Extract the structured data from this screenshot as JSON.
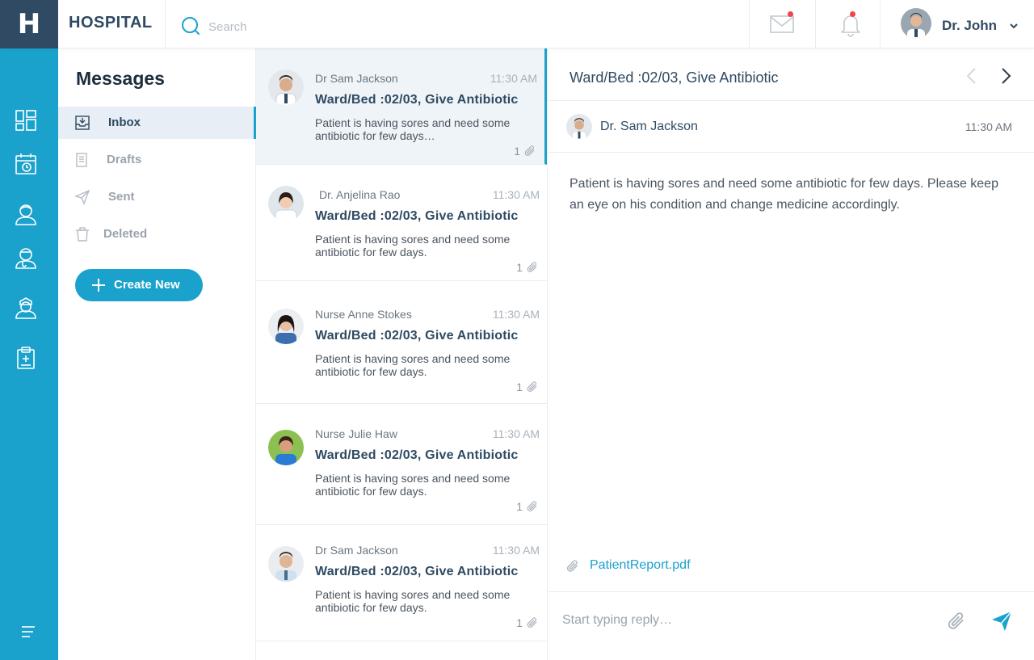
{
  "app": {
    "logo_letter": "H",
    "brand": "HOSPITAL"
  },
  "header": {
    "search_placeholder": "Search",
    "user_name": "Dr. John"
  },
  "folders": {
    "title": "Messages",
    "items": [
      {
        "label": "Inbox",
        "icon": "inbox-icon",
        "active": true
      },
      {
        "label": "Drafts",
        "icon": "drafts-icon",
        "active": false
      },
      {
        "label": "Sent",
        "icon": "sent-icon",
        "active": false
      },
      {
        "label": "Deleted",
        "icon": "trash-icon",
        "active": false
      }
    ],
    "create_label": "Create New"
  },
  "rail": {
    "icons": [
      "dashboard-icon",
      "appointments-icon",
      "patients-icon",
      "doctors-icon",
      "nurses-icon",
      "clipboard-icon",
      "menu-icon"
    ]
  },
  "messages": [
    {
      "sender": "Dr Sam Jackson",
      "time": "11:30 AM",
      "subject": "Ward/Bed :02/03, Give Antibiotic",
      "preview": "Patient is having sores and need some antibiotic for few days…",
      "attachments": "1"
    },
    {
      "sender": "Dr. Anjelina Rao",
      "time": "11:30 AM",
      "subject": "Ward/Bed :02/03, Give Antibiotic",
      "preview": "Patient is having sores and need some antibiotic for few days.",
      "attachments": "1"
    },
    {
      "sender": "Nurse Anne Stokes",
      "time": "11:30 AM",
      "subject": "Ward/Bed :02/03, Give Antibiotic",
      "preview": "Patient is having sores and need some antibiotic for few days.",
      "attachments": "1"
    },
    {
      "sender": "Nurse Julie Haw",
      "time": "11:30 AM",
      "subject": "Ward/Bed :02/03, Give Antibiotic",
      "preview": "Patient is having sores and need some antibiotic for few days.",
      "attachments": "1"
    },
    {
      "sender": "Dr Sam Jackson",
      "time": "11:30 AM",
      "subject": "Ward/Bed :02/03, Give Antibiotic",
      "preview": "Patient is having sores and need some antibiotic for few days.",
      "attachments": "1"
    }
  ],
  "reader": {
    "subject": "Ward/Bed :02/03, Give Antibiotic",
    "sender": "Dr. Sam Jackson",
    "time": "11:30 AM",
    "body": "Patient is having sores and need some antibiotic for few days. Please keep an eye on his condition and change medicine accordingly.",
    "attachment": "PatientReport.pdf",
    "reply_placeholder": "Start typing reply…"
  },
  "colors": {
    "accent": "#1aa2cd",
    "navy": "#2f4a62",
    "notification": "#f2434d"
  }
}
